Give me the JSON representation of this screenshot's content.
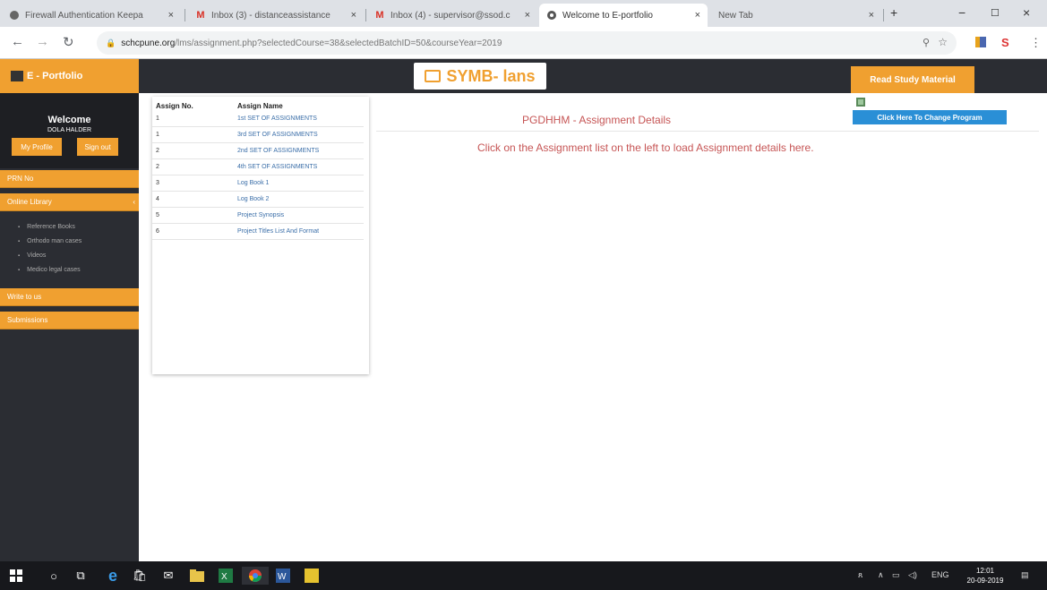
{
  "browser": {
    "tabs": [
      {
        "icon": "shield-icon",
        "label": "Firewall Authentication Keepa",
        "active": false
      },
      {
        "icon": "gmail-icon",
        "label": "Inbox (3) - distanceassistance",
        "active": false
      },
      {
        "icon": "gmail-icon",
        "label": "Inbox (4) - supervisor@ssod.c",
        "active": false
      },
      {
        "icon": "globe-icon",
        "label": "Welcome to E-portfolio",
        "active": true
      },
      {
        "icon": "",
        "label": "New Tab",
        "active": false
      }
    ],
    "close_glyph": "×",
    "new_tab_glyph": "+",
    "window_controls": {
      "minimize": "−",
      "restore": "☐",
      "close": "×"
    },
    "url_domain": "schcpune.org",
    "url_path": "/lms/assignment.php?selectedCourse=38&selectedBatchID=50&courseYear=2019"
  },
  "sidebar": {
    "brand": "E - Portfolio",
    "welcome": "Welcome",
    "username": "DOLA HALDER",
    "my_profile": "My Profile",
    "sign_out": "Sign out",
    "menu": [
      {
        "label": "PRN No"
      },
      {
        "label": "Online Library"
      },
      {
        "label": "Write to us"
      },
      {
        "label": "Submissions"
      }
    ],
    "library_sub": [
      "Reference Books",
      "Orthodo man cases",
      "Videos",
      "Medico legal cases"
    ]
  },
  "header": {
    "logo_text": "SYMB- lans",
    "read_study_material": "Read Study Material"
  },
  "assignments": {
    "col_no": "Assign No.",
    "col_name": "Assign Name",
    "rows": [
      {
        "no": "1",
        "name": "1st SET OF ASSIGNMENTS"
      },
      {
        "no": "1",
        "name": "3rd SET OF ASSIGNMENTS"
      },
      {
        "no": "2",
        "name": "2nd SET OF ASSIGNMENTS"
      },
      {
        "no": "2",
        "name": "4th SET OF ASSIGNMENTS"
      },
      {
        "no": "3",
        "name": "Log Book 1"
      },
      {
        "no": "4",
        "name": "Log Book 2"
      },
      {
        "no": "5",
        "name": "Project Synopsis"
      },
      {
        "no": "6",
        "name": "Project Titles List And Format"
      }
    ]
  },
  "details": {
    "title": "PGDHHM - Assignment Details",
    "info": "Click on the Assignment list on the left to load Assignment details here.",
    "change_program": "Click Here To Change Program"
  },
  "taskbar": {
    "language": "ENG",
    "time": "12:01",
    "date": "20-09-2019"
  },
  "colors": {
    "accent": "#f0a030",
    "sidebar_bg": "#2b2d33",
    "detail_text": "#c65555",
    "link": "#3a6ea8",
    "change_button": "#2a8fd6"
  }
}
